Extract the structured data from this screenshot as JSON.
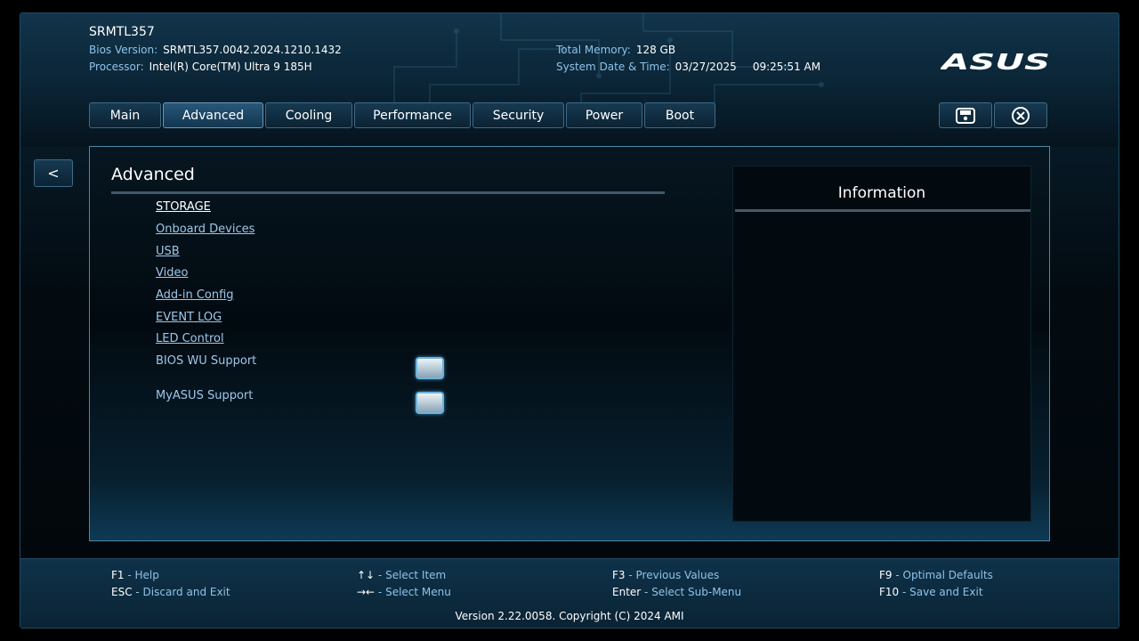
{
  "header": {
    "model": "SRMTL357",
    "bios_version_label": "Bios Version:",
    "bios_version": "SRMTL357.0042.2024.1210.1432",
    "processor_label": "Processor:",
    "processor": "Intel(R) Core(TM) Ultra 9 185H",
    "memory_label": "Total Memory:",
    "memory": "128 GB",
    "datetime_label": "System Date & Time:",
    "date": "03/27/2025",
    "time": "09:25:51 AM",
    "logo": "ASUS"
  },
  "tabs": [
    {
      "label": "Main"
    },
    {
      "label": "Advanced",
      "active": true
    },
    {
      "label": "Cooling"
    },
    {
      "label": "Performance"
    },
    {
      "label": "Security"
    },
    {
      "label": "Power"
    },
    {
      "label": "Boot"
    }
  ],
  "toolbar": {
    "save_icon": "save-icon",
    "exit_icon": "close-circle-icon",
    "back_label": "<"
  },
  "main": {
    "title": "Advanced",
    "menu_items": [
      {
        "label": "STORAGE",
        "selected": true
      },
      {
        "label": "Onboard Devices"
      },
      {
        "label": "USB"
      },
      {
        "label": "Video"
      },
      {
        "label": "Add-in Config"
      },
      {
        "label": "EVENT LOG"
      },
      {
        "label": "LED Control"
      }
    ],
    "settings": [
      {
        "label": "BIOS WU Support",
        "checked": false
      },
      {
        "label": "MyASUS Support",
        "checked": false
      }
    ]
  },
  "info_panel": {
    "title": "Information"
  },
  "footer": {
    "hints": [
      {
        "key": "F1",
        "desc": "Help"
      },
      {
        "key": "ESC",
        "desc": "Discard and Exit"
      },
      {
        "key": "↑↓",
        "desc": "Select Item"
      },
      {
        "key": "→←",
        "desc": "Select Menu"
      },
      {
        "key": "F3",
        "desc": "Previous Values"
      },
      {
        "key": "Enter",
        "desc": "Select Sub-Menu"
      },
      {
        "key": "F9",
        "desc": "Optimal Defaults"
      },
      {
        "key": "F10",
        "desc": "Save and Exit"
      }
    ],
    "version": "Version 2.22.0058. Copyright (C) 2024 AMI"
  },
  "colors": {
    "accent": "#8ec3e8",
    "link": "#9ec7ea",
    "panel_border": "#4e87a8"
  }
}
